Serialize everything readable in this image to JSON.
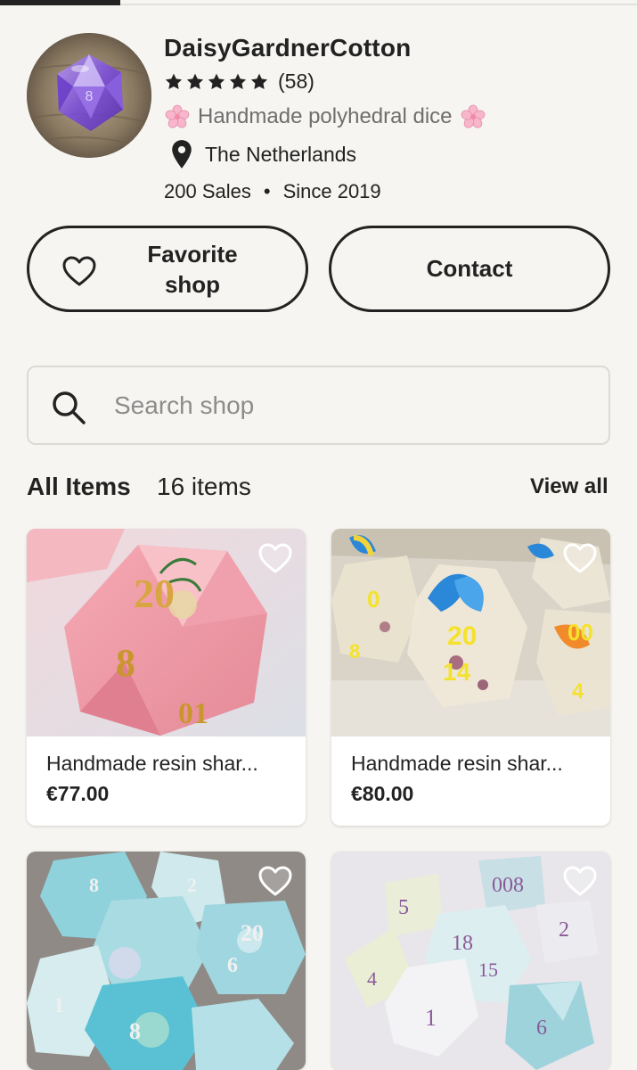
{
  "shop": {
    "name": "DaisyGardnerCotton",
    "rating_stars": 5,
    "review_count": "(58)",
    "tagline": "Handmade polyhedral dice",
    "location": "The Netherlands",
    "sales": "200 Sales",
    "separator": "•",
    "since": "Since 2019"
  },
  "actions": {
    "favorite_label": "Favorite shop",
    "contact_label": "Contact"
  },
  "search": {
    "placeholder": "Search shop"
  },
  "items": {
    "title": "All Items",
    "count": "16 items",
    "view_all": "View all",
    "cards": [
      {
        "title": "Handmade resin shar...",
        "price": "€77.00"
      },
      {
        "title": "Handmade resin shar...",
        "price": "€80.00"
      },
      {
        "title": "",
        "price": ""
      },
      {
        "title": "",
        "price": ""
      }
    ]
  },
  "icons": [
    "star-icon",
    "cherry-blossom-icon",
    "map-pin-icon",
    "heart-icon",
    "search-icon"
  ],
  "colors": {
    "background": "#f6f5f1",
    "text": "#222222",
    "muted": "#6e6e6e",
    "blossom": "#f4a7c0"
  }
}
